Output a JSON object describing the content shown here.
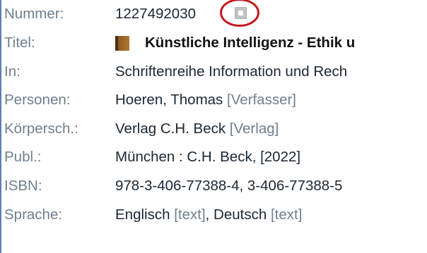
{
  "fields": {
    "nummer": {
      "label": "Nummer:",
      "value": "1227492030"
    },
    "titel": {
      "label": "Titel:",
      "value": "Künstliche Intelligenz - Ethik u"
    },
    "in": {
      "label": "In:",
      "value": "Schriftenreihe Information und Rech"
    },
    "personen": {
      "label": "Personen:",
      "name": "Hoeren, Thomas",
      "role": "[Verfasser]"
    },
    "koerpersch": {
      "label": "Körpersch.:",
      "name": "Verlag C.H. Beck",
      "role": "[Verlag]"
    },
    "publ": {
      "label": "Publ.:",
      "value": "München : C.H. Beck, [2022]"
    },
    "isbn": {
      "label": "ISBN:",
      "value": "978-3-406-77388-4, 3-406-77388-5"
    },
    "sprache": {
      "label": "Sprache:",
      "lang1": "Englisch",
      "role1": "[text]",
      "separator": ",",
      "lang2": "Deutsch",
      "role2": "[text]"
    }
  },
  "icons": {
    "copy": "copy-permalink-icon",
    "book": "book-icon"
  },
  "colors": {
    "label": "#6f7f8f",
    "value": "#1b2733",
    "highlight": "#c4161c",
    "accent_rule": "#5a7fb4"
  }
}
